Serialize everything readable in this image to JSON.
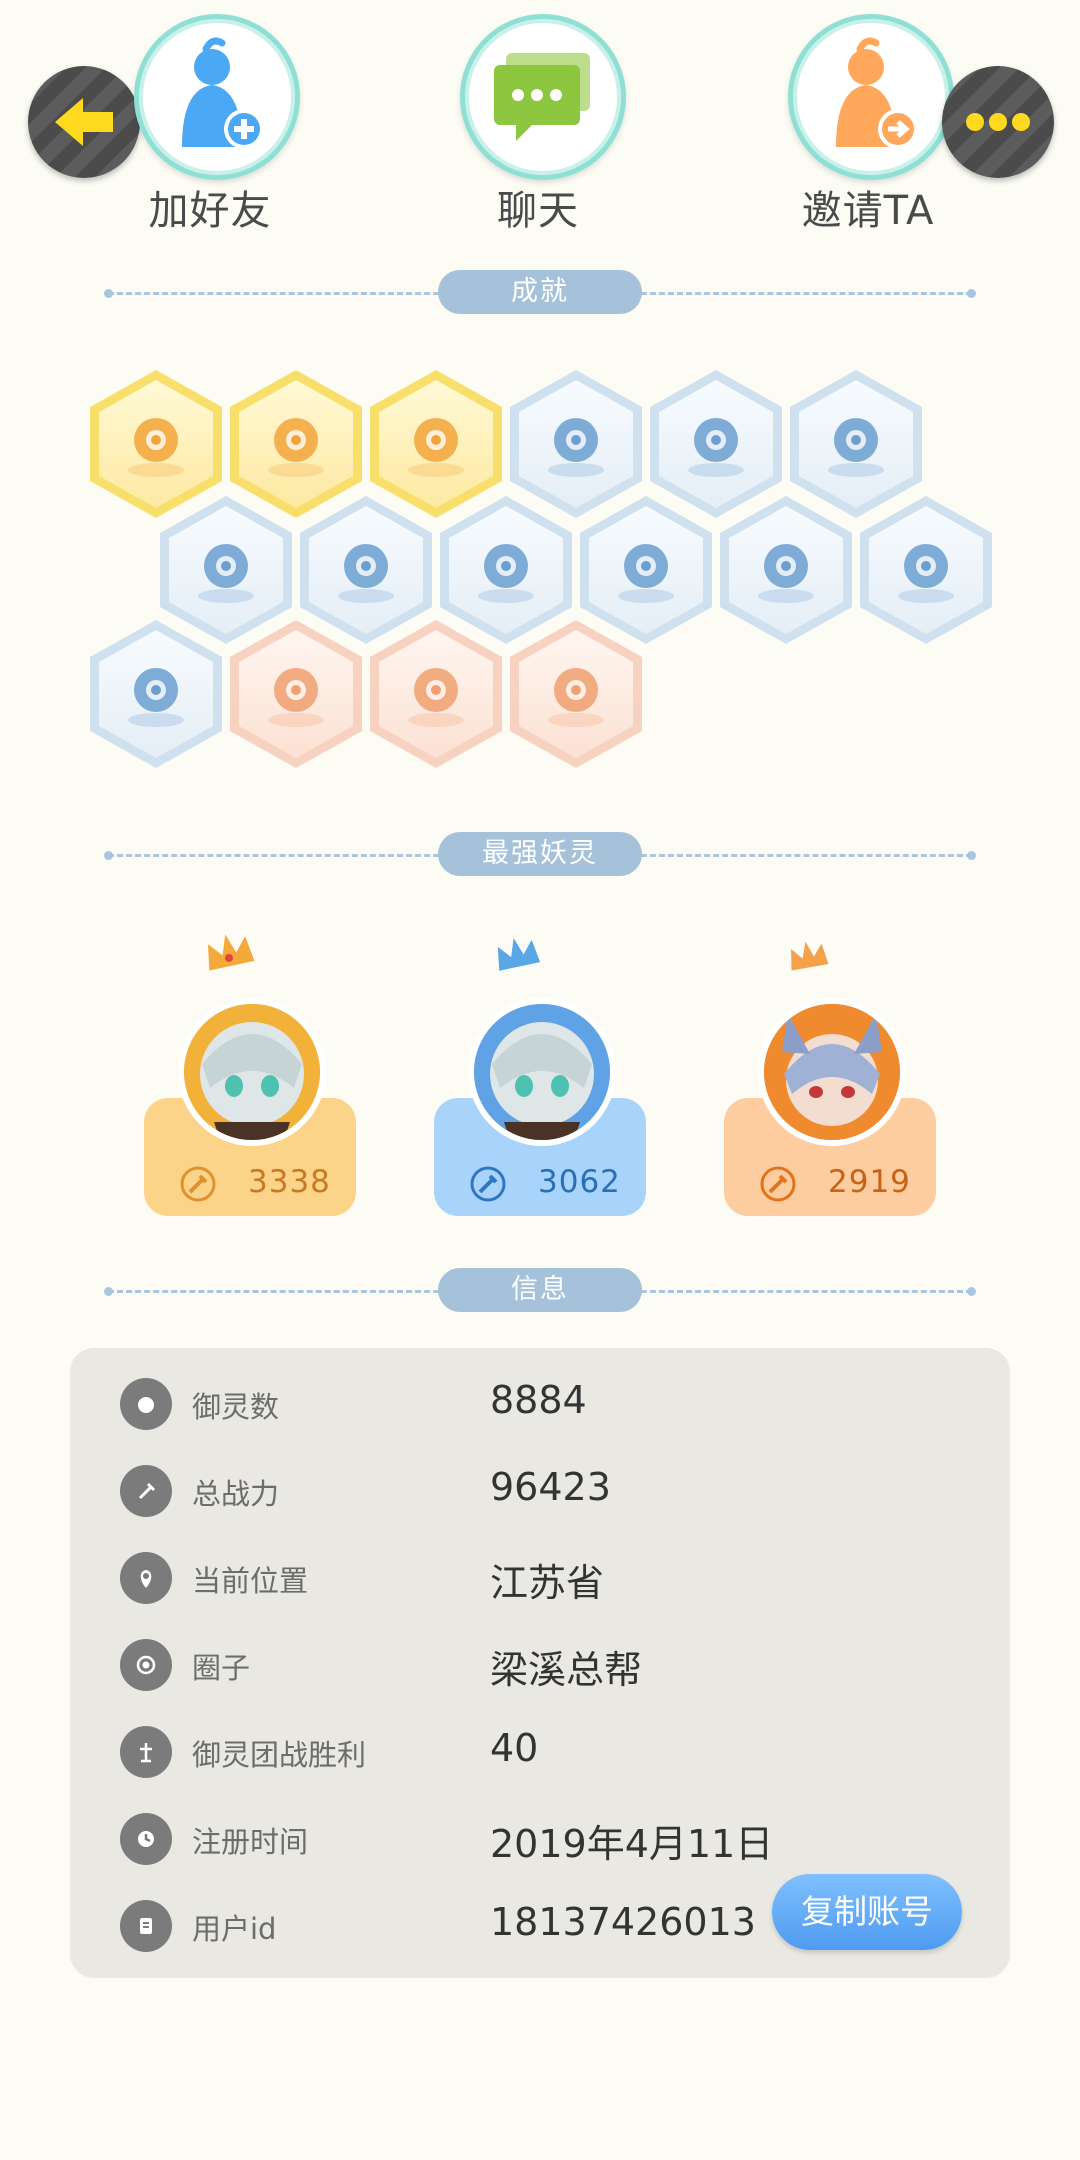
{
  "actions": {
    "back_icon": "arrow-left-icon",
    "more_icon": "more-dots-icon",
    "add_friend": "加好友",
    "chat": "聊天",
    "invite": "邀请TA"
  },
  "sections": {
    "achievements": "成就",
    "top_spirits": "最强妖灵",
    "info": "信息"
  },
  "achievements": [
    {
      "tier": "gold",
      "icon": "sneaker-icon"
    },
    {
      "tier": "gold",
      "icon": "horned-spirit-icon"
    },
    {
      "tier": "gold",
      "icon": "fox-balloon-icon"
    },
    {
      "tier": "blue",
      "icon": "orb-antenna-icon"
    },
    {
      "tier": "blue",
      "icon": "moon-icon"
    },
    {
      "tier": "blue",
      "icon": "crystal-ball-icon"
    },
    {
      "tier": "blue",
      "icon": "crystal-icon"
    },
    {
      "tier": "blue",
      "icon": "yinyang-wave-icon"
    },
    {
      "tier": "blue",
      "icon": "statue-icon"
    },
    {
      "tier": "blue",
      "icon": "stroller-icon"
    },
    {
      "tier": "blue",
      "icon": "yinyang-book-icon"
    },
    {
      "tier": "blue",
      "icon": "shield-icon"
    },
    {
      "tier": "blue",
      "icon": "blob-spirit-icon"
    },
    {
      "tier": "peach",
      "icon": "koi-icon"
    },
    {
      "tier": "peach",
      "icon": "pedestal-spirit-icon"
    },
    {
      "tier": "peach",
      "icon": "open-book-icon"
    }
  ],
  "top_spirits": [
    {
      "power": "3338",
      "theme": "gold",
      "card_color": "#fcd489",
      "accent": "#e0912b"
    },
    {
      "power": "3062",
      "theme": "blue",
      "card_color": "#a8d4fb",
      "accent": "#2f77c2"
    },
    {
      "power": "2919",
      "theme": "orange",
      "card_color": "#fdcc9f",
      "accent": "#e0741e"
    }
  ],
  "info": {
    "rows": [
      {
        "icon": "spirit-icon",
        "label": "御灵数",
        "value": "8884"
      },
      {
        "icon": "sword-icon",
        "label": "总战力",
        "value": "96423"
      },
      {
        "icon": "location-pin-icon",
        "label": "当前位置",
        "value": "江苏省"
      },
      {
        "icon": "circle-target-icon",
        "label": "圈子",
        "value": "梁溪总帮"
      },
      {
        "icon": "trophy-icon",
        "label": "御灵团战胜利",
        "value": "40"
      },
      {
        "icon": "clock-icon",
        "label": "注册时间",
        "value": "2019年4月11日"
      },
      {
        "icon": "id-card-icon",
        "label": "用户id",
        "value": "18137426013"
      }
    ],
    "copy_button": "复制账号"
  },
  "colors": {
    "background": "#fcfcf5",
    "section_pill": "#a6c2da",
    "copy_button": "#5ea8f6",
    "gold": "#f8df6b",
    "blue_badge": "#cfe1ef",
    "peach_badge": "#f7d2c0"
  }
}
